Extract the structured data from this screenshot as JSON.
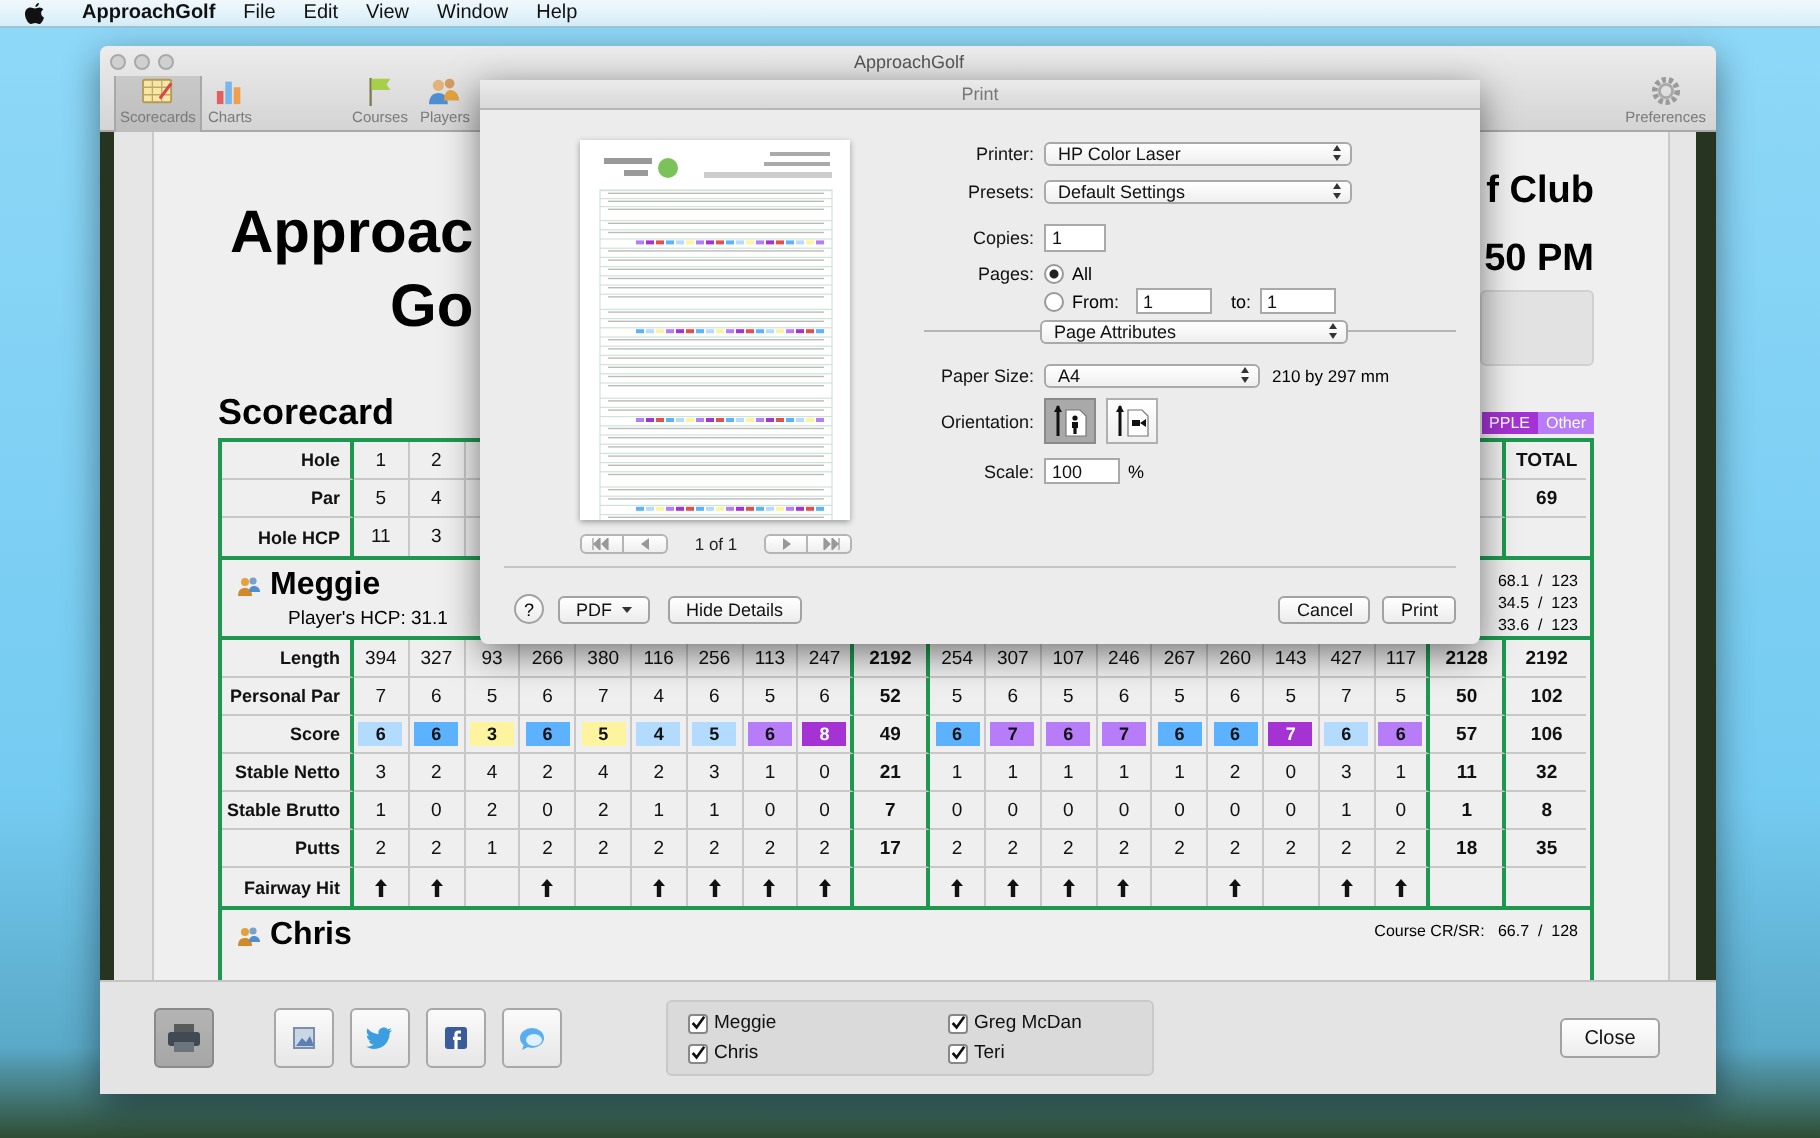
{
  "menubar": {
    "app": "ApproachGolf",
    "items": [
      "File",
      "Edit",
      "View",
      "Window",
      "Help"
    ]
  },
  "window": {
    "title": "ApproachGolf",
    "toolbar": [
      {
        "label": "Scorecards",
        "selected": true
      },
      {
        "label": "Charts",
        "selected": false
      },
      {
        "label": "Courses",
        "selected": false
      },
      {
        "label": "Players",
        "selected": false
      },
      {
        "label": "Preferences",
        "selected": false
      }
    ]
  },
  "document": {
    "title_lines": [
      "Approac",
      "Go"
    ],
    "club_lines": [
      "f Club",
      "50 PM"
    ],
    "section_title": "Scorecard",
    "legend": [
      {
        "label": "PPLE",
        "color": "#a533d4"
      },
      {
        "label": "Other",
        "color": "#b77cf7"
      }
    ],
    "course_rows": [
      {
        "label": "Hole",
        "values": [
          "1",
          "2"
        ],
        "total": "TOTAL"
      },
      {
        "label": "Par",
        "values": [
          "5",
          "4"
        ],
        "total": "69"
      },
      {
        "label": "Hole HCP",
        "values": [
          "11",
          "3"
        ]
      }
    ],
    "players": [
      {
        "name": "Meggie",
        "hcp": "Player's HCP:  31.1",
        "ratings": [
          "68.1  /  123",
          "34.5  /  123",
          "33.6  /  123"
        ],
        "rows": [
          {
            "kind": "number",
            "label": "Length",
            "front": [
              "394",
              "327",
              "93",
              "266",
              "380",
              "116",
              "256",
              "113",
              "247"
            ],
            "out": "2192",
            "back": [
              "254",
              "307",
              "107",
              "246",
              "267",
              "260",
              "143",
              "427",
              "117"
            ],
            "in": "2128",
            "total": "2192"
          },
          {
            "kind": "number",
            "label": "Personal Par",
            "front": [
              "7",
              "6",
              "5",
              "6",
              "7",
              "4",
              "6",
              "5",
              "6"
            ],
            "out": "52",
            "back": [
              "5",
              "6",
              "5",
              "6",
              "5",
              "6",
              "5",
              "7",
              "5"
            ],
            "in": "50",
            "total": "102"
          },
          {
            "kind": "score",
            "label": "Score",
            "front": [
              {
                "value": "6",
                "color": "#b3dbff"
              },
              {
                "value": "6",
                "color": "#5cb2ff"
              },
              {
                "value": "3",
                "color": "#fdf4a0"
              },
              {
                "value": "6",
                "color": "#5cb2ff"
              },
              {
                "value": "5",
                "color": "#fdf4a0"
              },
              {
                "value": "4",
                "color": "#b3dbff"
              },
              {
                "value": "5",
                "color": "#b3dbff"
              },
              {
                "value": "6",
                "color": "#b77cf7"
              },
              {
                "value": "8",
                "color": "#a533d4"
              }
            ],
            "out": "49",
            "back": [
              {
                "value": "6",
                "color": "#5cb2ff"
              },
              {
                "value": "7",
                "color": "#b77cf7"
              },
              {
                "value": "6",
                "color": "#b77cf7"
              },
              {
                "value": "7",
                "color": "#b77cf7"
              },
              {
                "value": "6",
                "color": "#5cb2ff"
              },
              {
                "value": "6",
                "color": "#5cb2ff"
              },
              {
                "value": "7",
                "color": "#a533d4"
              },
              {
                "value": "6",
                "color": "#b3dbff"
              },
              {
                "value": "6",
                "color": "#b77cf7"
              }
            ],
            "in": "57",
            "total": "106"
          },
          {
            "kind": "number",
            "label": "Stable Netto",
            "front": [
              "3",
              "2",
              "4",
              "2",
              "4",
              "2",
              "3",
              "1",
              "0"
            ],
            "out": "21",
            "back": [
              "1",
              "1",
              "1",
              "1",
              "1",
              "2",
              "0",
              "3",
              "1"
            ],
            "in": "11",
            "total": "32"
          },
          {
            "kind": "number",
            "label": "Stable Brutto",
            "front": [
              "1",
              "0",
              "2",
              "0",
              "2",
              "1",
              "1",
              "0",
              "0"
            ],
            "out": "7",
            "back": [
              "0",
              "0",
              "0",
              "0",
              "0",
              "0",
              "0",
              "1",
              "0"
            ],
            "in": "1",
            "total": "8"
          },
          {
            "kind": "number",
            "label": "Putts",
            "front": [
              "2",
              "2",
              "1",
              "2",
              "2",
              "2",
              "2",
              "2",
              "2"
            ],
            "out": "17",
            "back": [
              "2",
              "2",
              "2",
              "2",
              "2",
              "2",
              "2",
              "2",
              "2"
            ],
            "in": "18",
            "total": "35"
          },
          {
            "kind": "fairway",
            "label": "Fairway Hit",
            "front": [
              true,
              true,
              false,
              true,
              false,
              true,
              true,
              true,
              true
            ],
            "back": [
              true,
              true,
              true,
              true,
              false,
              true,
              false,
              true,
              true
            ]
          }
        ]
      },
      {
        "name": "Chris",
        "ratings": [
          "Course CR/SR:   66.7  /  128"
        ]
      }
    ]
  },
  "bottom_bar": {
    "share_buttons": [
      {
        "selected": true
      },
      {
        "selected": false
      },
      {
        "selected": false
      },
      {
        "selected": false
      },
      {
        "selected": false
      }
    ],
    "players": [
      {
        "label": "Meggie",
        "checked": true
      },
      {
        "label": "Greg McDan",
        "checked": true
      },
      {
        "label": "Chris",
        "checked": true
      },
      {
        "label": "Teri",
        "checked": true
      }
    ],
    "close": "Close"
  },
  "print_dialog": {
    "title": "Print",
    "page_indicator": "1 of 1",
    "printer_label": "Printer:",
    "printer": "HP Color Laser",
    "presets_label": "Presets:",
    "presets": "Default Settings",
    "copies_label": "Copies:",
    "copies": "1",
    "pages_label": "Pages:",
    "pages_options": [
      {
        "label": "All",
        "selected": true
      },
      {
        "label": "From:",
        "selected": false
      }
    ],
    "from": "1",
    "to_label": "to:",
    "to": "1",
    "section": "Page Attributes",
    "paper_size_label": "Paper Size:",
    "paper_size": "A4",
    "paper_dimensions": "210 by 297 mm",
    "orientation_label": "Orientation:",
    "orientation": [
      {
        "selected": true
      },
      {
        "selected": false
      }
    ],
    "scale_label": "Scale:",
    "scale": "100",
    "scale_unit": "%",
    "help": "?",
    "pdf": "PDF",
    "hide_details": "Hide Details",
    "cancel": "Cancel",
    "print": "Print"
  }
}
